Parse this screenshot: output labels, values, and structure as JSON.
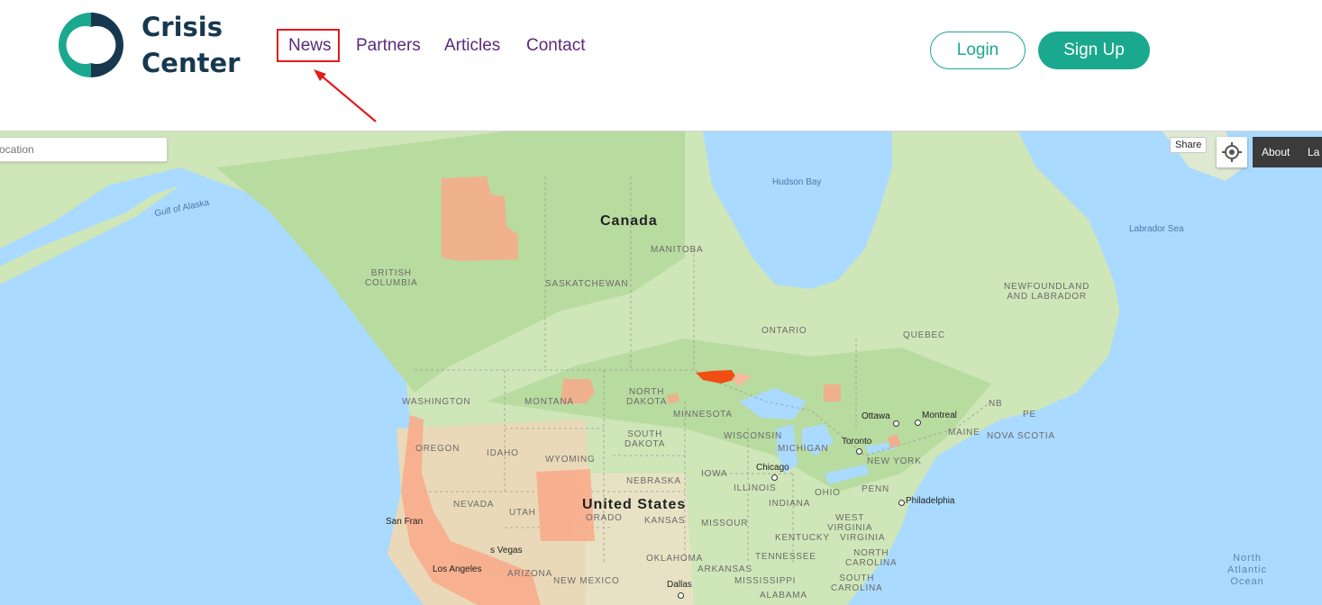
{
  "brand": {
    "line1": "Crisis",
    "line2": "Center",
    "colors": {
      "teal": "#1aa88e",
      "navy": "#17384f"
    }
  },
  "nav": [
    {
      "label": "News"
    },
    {
      "label": "Partners"
    },
    {
      "label": "Articles"
    },
    {
      "label": "Contact"
    }
  ],
  "auth": {
    "login": "Login",
    "signup": "Sign Up"
  },
  "map": {
    "search_placeholder": "ocation",
    "share": "Share",
    "locate_icon": "crosshair-icon",
    "about": "About",
    "layers_partial": "La",
    "labels": {
      "canada": "Canada",
      "united_states": "United States",
      "hudson_bay": "Hudson Bay",
      "gulf_of_alaska": "Gulf of Alaska",
      "labrador_sea": "Labrador Sea",
      "north_atlantic": "North\nAtlantic\nOcean",
      "manitoba": "MANITOBA",
      "saskatchewan": "SASKATCHEWAN",
      "british_columbia": "BRITISH\nCOLUMBIA",
      "ontario": "ONTARIO",
      "quebec": "QUEBEC",
      "newfoundland": "NEWFOUNDLAND\nAND LABRADOR",
      "nb": "NB",
      "pe": "PE",
      "nova_scotia": "NOVA SCOTIA",
      "washington": "WASHINGTON",
      "oregon": "OREGON",
      "idaho": "IDAHO",
      "montana": "MONTANA",
      "wyoming": "WYOMING",
      "nevada": "NEVADA",
      "utah": "UTAH",
      "colorado": "ORADO",
      "north_dakota": "NORTH\nDAKOTA",
      "south_dakota": "SOUTH\nDAKOTA",
      "nebraska": "NEBRASKA",
      "kansas": "KANSAS",
      "oklahoma": "OKLAHOMA",
      "new_mexico": "NEW MEXICO",
      "arizona": "ARIZONA",
      "minnesota": "MINNESOTA",
      "iowa": "IOWA",
      "missouri": "MISSOUR",
      "arkansas": "ARKANSAS",
      "wisconsin": "WISCONSIN",
      "illinois": "ILLINOIS",
      "michigan": "MICHIGAN",
      "indiana": "INDIANA",
      "ohio": "OHIO",
      "kentucky": "KENTUCKY",
      "tennessee": "TENNESSEE",
      "mississippi": "MISSISSIPPI",
      "alabama": "ALABAMA",
      "west_virginia": "WEST\nVIRGINIA",
      "virginia": "VIRGINIA",
      "north_carolina": "NORTH\nCAROLINA",
      "south_carolina": "SOUTH\nCAROLINA",
      "pennsylvania": "PENN",
      "new_york": "NEW YORK",
      "maine": "MAINE",
      "ottawa": "Ottawa",
      "montreal": "Montreal",
      "toronto": "Toronto",
      "chicago": "Chicago",
      "philadelphia": "Philadelphia",
      "san_francisco": "San Fran",
      "las_vegas": "s Vegas",
      "los_angeles": "Los Angeles",
      "dallas": "Dallas"
    }
  }
}
